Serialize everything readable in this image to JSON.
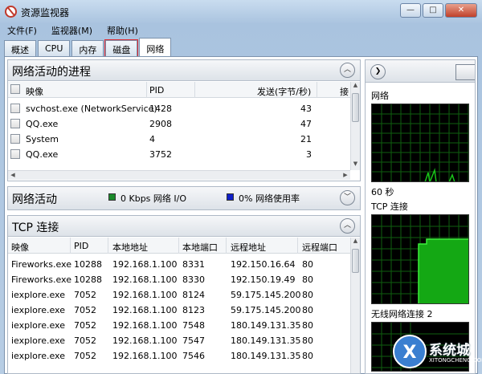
{
  "window": {
    "title": "资源监视器",
    "minimize": "—",
    "maximize": "□",
    "close": "✕"
  },
  "menu": [
    "文件(F)",
    "监视器(M)",
    "帮助(H)"
  ],
  "tabs": [
    "概述",
    "CPU",
    "内存",
    "磁盘",
    "网络"
  ],
  "processes": {
    "title": "网络活动的进程",
    "columns": [
      "映像",
      "PID",
      "发送(字节/秒)",
      "接"
    ],
    "rows": [
      {
        "image": "svchost.exe (NetworkService)",
        "pid": "1428",
        "send": "43"
      },
      {
        "image": "QQ.exe",
        "pid": "2908",
        "send": "47"
      },
      {
        "image": "System",
        "pid": "4",
        "send": "21"
      },
      {
        "image": "QQ.exe",
        "pid": "3752",
        "send": "3"
      }
    ]
  },
  "network_activity": {
    "title": "网络活动",
    "io_label": "0 Kbps 网络 I/O",
    "usage_label": "0% 网络使用率",
    "io_color": "#1a8a2a",
    "usage_color": "#1020c8"
  },
  "tcp": {
    "title": "TCP 连接",
    "columns": [
      "映像",
      "PID",
      "本地地址",
      "本地端口",
      "远程地址",
      "远程端口"
    ],
    "rows": [
      {
        "image": "Fireworks.exe",
        "pid": "10288",
        "local": "192.168.1.100",
        "lport": "8331",
        "remote": "192.150.16.64",
        "rport": "80"
      },
      {
        "image": "Fireworks.exe",
        "pid": "10288",
        "local": "192.168.1.100",
        "lport": "8330",
        "remote": "192.150.19.49",
        "rport": "80"
      },
      {
        "image": "iexplore.exe",
        "pid": "7052",
        "local": "192.168.1.100",
        "lport": "8124",
        "remote": "59.175.145.200",
        "rport": "80"
      },
      {
        "image": "iexplore.exe",
        "pid": "7052",
        "local": "192.168.1.100",
        "lport": "8123",
        "remote": "59.175.145.200",
        "rport": "80"
      },
      {
        "image": "iexplore.exe",
        "pid": "7052",
        "local": "192.168.1.100",
        "lport": "7548",
        "remote": "180.149.131.35",
        "rport": "80"
      },
      {
        "image": "iexplore.exe",
        "pid": "7052",
        "local": "192.168.1.100",
        "lport": "7547",
        "remote": "180.149.131.35",
        "rport": "80"
      },
      {
        "image": "iexplore.exe",
        "pid": "7052",
        "local": "192.168.1.100",
        "lport": "7546",
        "remote": "180.149.131.35",
        "rport": "80"
      }
    ]
  },
  "side": {
    "network_label": "网络",
    "time_label": "60 秒",
    "tcp_label": "TCP 连接",
    "wireless_label": "无线网络连接 2",
    "graph_color": "#18c418"
  },
  "watermark": {
    "brand": "系统城",
    "site": "XITONGCHENG.COM"
  }
}
